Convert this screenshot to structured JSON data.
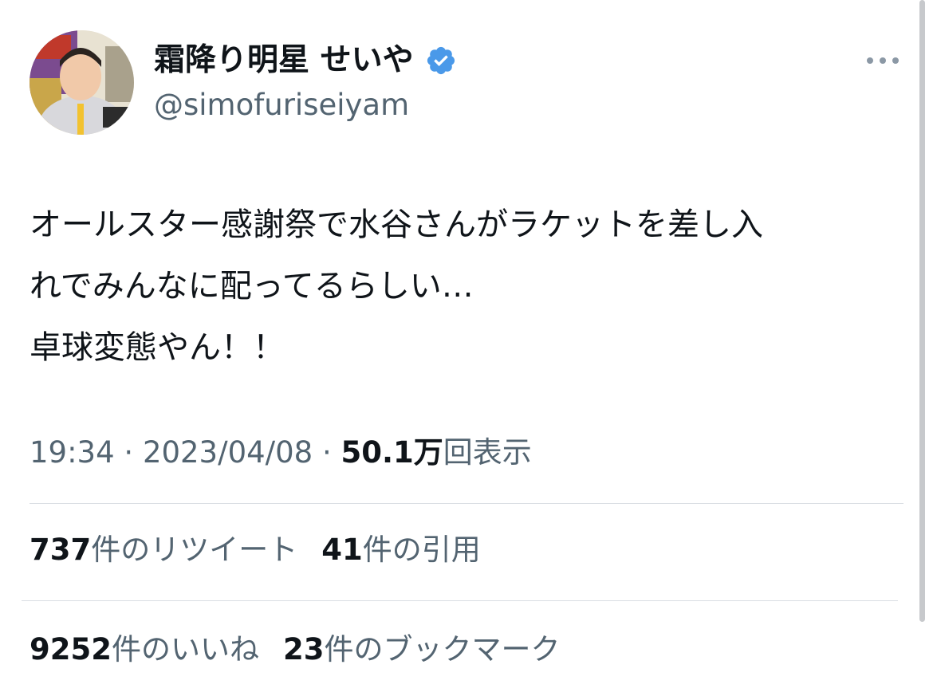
{
  "tweet": {
    "author": {
      "display_name": "霜降り明星 せいや",
      "handle": "@simofuriseiyam",
      "verified": true,
      "verified_color": "#4a99e9"
    },
    "text_lines": [
      "オールスター感謝祭で水谷さんがラケットを差し入",
      "れでみんなに配ってるらしい…",
      "卓球変態やん！！"
    ],
    "meta": {
      "time": "19:34",
      "separator": " · ",
      "date": "2023/04/08",
      "views_value": "50.1万",
      "views_label": "回表示"
    },
    "stats_row1": [
      {
        "value": "737",
        "label": "件のリツイート"
      },
      {
        "value": "41",
        "label": "件の引用"
      }
    ],
    "stats_row2": [
      {
        "value": "9252",
        "label": "件のいいね"
      },
      {
        "value": "23",
        "label": "件のブックマーク"
      }
    ]
  },
  "icons": {
    "verified": "verified-badge-icon",
    "more": "more-dots-icon"
  },
  "colors": {
    "text_primary": "#0f1419",
    "text_secondary": "#536471",
    "divider": "#d9dee3",
    "background": "#ffffff"
  }
}
